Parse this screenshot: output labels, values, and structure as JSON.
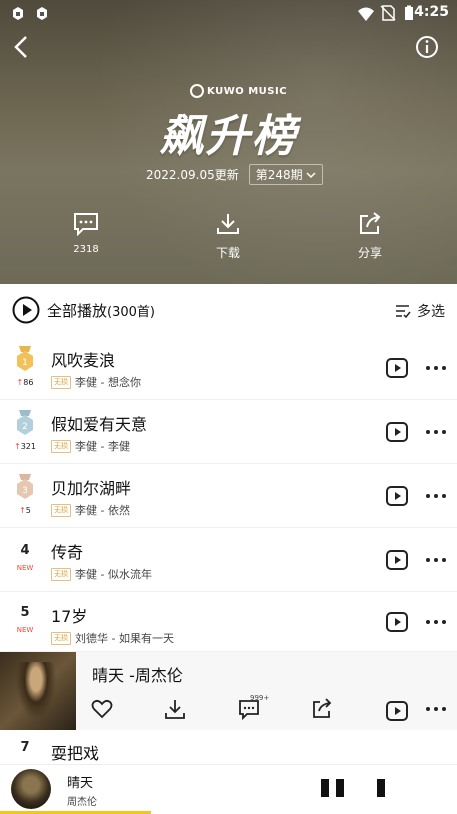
{
  "status_bar": {
    "time": "4:25",
    "left_icons": [
      "app-notification-icon",
      "app-notification-icon"
    ],
    "right_icons": [
      "wifi-icon",
      "no-sim-icon",
      "battery-icon"
    ]
  },
  "header": {
    "brand": "KUWO MUSIC",
    "title": "飙升榜",
    "updated": "2022.09.05更新",
    "period": "第248期",
    "actions": [
      {
        "label": "2318",
        "icon": "comment-icon"
      },
      {
        "label": "下载",
        "icon": "download-icon"
      },
      {
        "label": "分享",
        "icon": "share-icon"
      }
    ]
  },
  "toolbar": {
    "play_all": "全部播放",
    "count": "(300首)",
    "multi_select": "多选"
  },
  "lossless_badge": "无损",
  "songs": [
    {
      "rank": "1",
      "title": "风吹麦浪",
      "artist_album": "李健 - 想念你",
      "change": "86",
      "change_dir": "up",
      "medal": "gold"
    },
    {
      "rank": "2",
      "title": "假如爱有天意",
      "artist_album": "李健 - 李健",
      "change": "321",
      "change_dir": "up",
      "medal": "silver"
    },
    {
      "rank": "3",
      "title": "贝加尔湖畔",
      "artist_album": "李健 - 依然",
      "change": "5",
      "change_dir": "up",
      "medal": "bronze"
    },
    {
      "rank": "4",
      "title": "传奇",
      "artist_album": "李健 - 似水流年",
      "change": "NEW",
      "change_dir": "new"
    },
    {
      "rank": "5",
      "title": "17岁",
      "artist_album": "刘德华 - 如果有一天",
      "change": "NEW",
      "change_dir": "new"
    }
  ],
  "expanded_song": {
    "title": "晴天 -周杰伦",
    "comment_badge": "999+",
    "actions": [
      "heart-icon",
      "download-icon",
      "comment-icon",
      "share-icon",
      "mv-icon",
      "more-icon"
    ]
  },
  "next_song": {
    "rank": "7",
    "title": "耍把戏"
  },
  "player": {
    "title": "晴天",
    "artist": "周杰伦",
    "progress": 0.33
  },
  "colors": {
    "accent": "#f5c518",
    "rank_up": "#e84a3c",
    "lossless": "#d9a441"
  }
}
